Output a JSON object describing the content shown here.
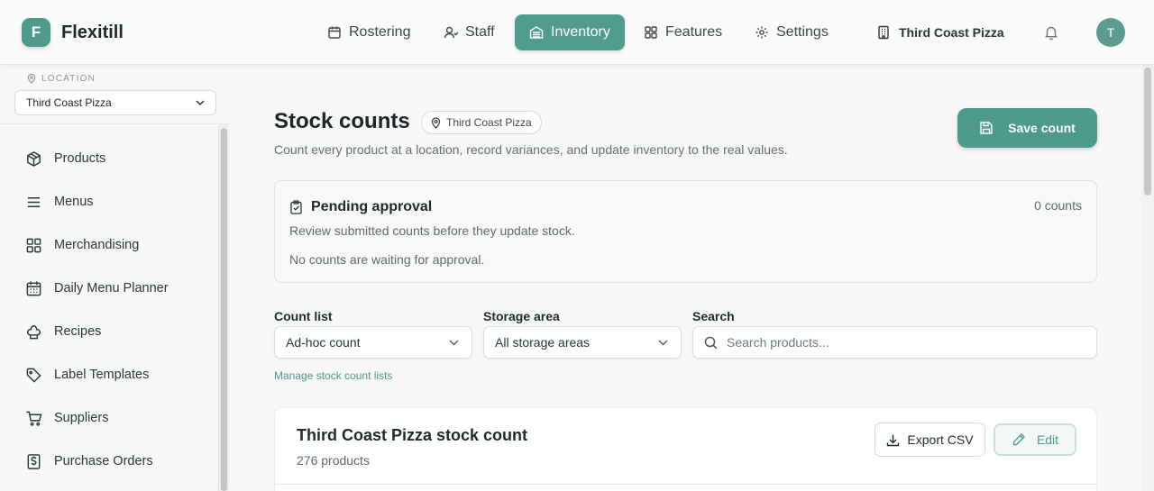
{
  "app": {
    "logo_letter": "F",
    "name": "Flexitill"
  },
  "nav": {
    "items": [
      {
        "label": "Rostering",
        "icon": "calendar-icon"
      },
      {
        "label": "Staff",
        "icon": "user-icon"
      },
      {
        "label": "Inventory",
        "icon": "inventory-icon",
        "active": true
      },
      {
        "label": "Features",
        "icon": "grid-icon"
      },
      {
        "label": "Settings",
        "icon": "gear-icon"
      }
    ],
    "location": "Third Coast Pizza",
    "avatar_initial": "T"
  },
  "sidebar": {
    "location_label": "LOCATION",
    "location_value": "Third Coast Pizza",
    "items": [
      {
        "label": "Products",
        "icon": "box-icon"
      },
      {
        "label": "Menus",
        "icon": "menu-icon"
      },
      {
        "label": "Merchandising",
        "icon": "grid-icon"
      },
      {
        "label": "Daily Menu Planner",
        "icon": "calendar-icon"
      },
      {
        "label": "Recipes",
        "icon": "chef-hat-icon"
      },
      {
        "label": "Label Templates",
        "icon": "tag-icon"
      },
      {
        "label": "Suppliers",
        "icon": "cart-icon"
      },
      {
        "label": "Purchase Orders",
        "icon": "dollar-doc-icon"
      }
    ]
  },
  "page": {
    "title": "Stock counts",
    "location_chip": "Third Coast Pizza",
    "subtitle": "Count every product at a location, record variances, and update inventory to the real values.",
    "save_label": "Save count"
  },
  "pending": {
    "title": "Pending approval",
    "count": "0 counts",
    "description": "Review submitted counts before they update stock.",
    "empty": "No counts are waiting for approval."
  },
  "filters": {
    "count_list_label": "Count list",
    "count_list_value": "Ad-hoc count",
    "storage_label": "Storage area",
    "storage_value": "All storage areas",
    "search_label": "Search",
    "search_placeholder": "Search products...",
    "manage_link": "Manage stock count lists"
  },
  "card": {
    "title": "Third Coast Pizza stock count",
    "subtitle": "276 products",
    "export_label": "Export CSV",
    "edit_label": "Edit"
  },
  "colors": {
    "accent": "#4e9a8c",
    "background": "#f6f7f6"
  }
}
